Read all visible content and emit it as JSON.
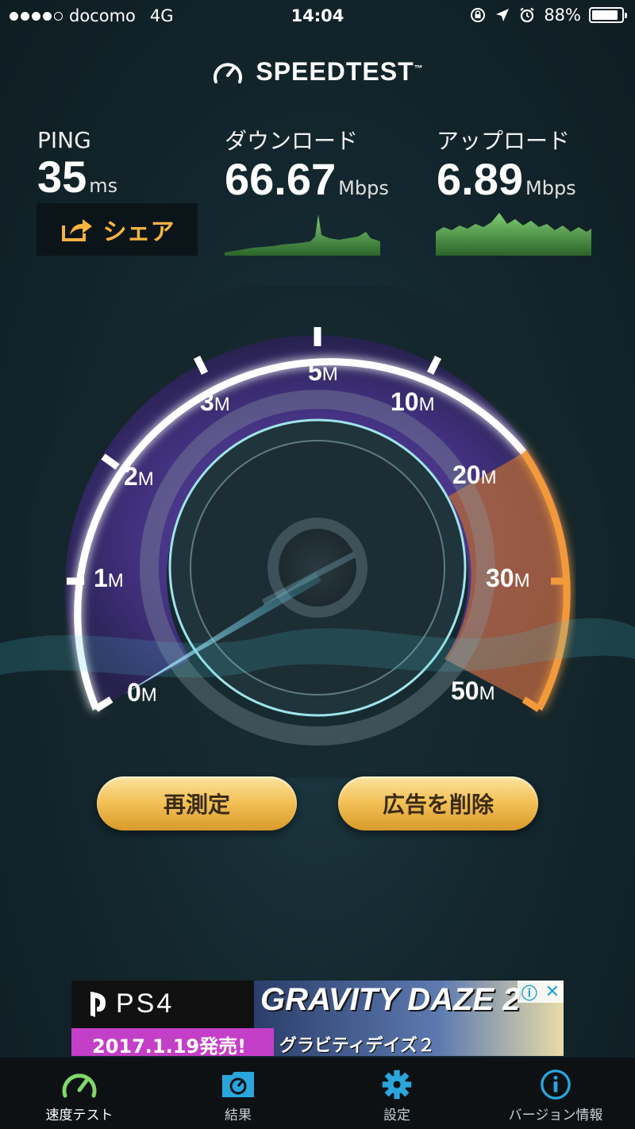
{
  "status_bar": {
    "carrier": "docomo",
    "network": "4G",
    "time": "14:04",
    "battery_pct": "88%",
    "battery_level": 0.88
  },
  "header": {
    "logo_text": "SPEEDTEST",
    "trademark": "™"
  },
  "results": {
    "ping": {
      "label": "PING",
      "value": "35",
      "unit": "ms"
    },
    "download": {
      "label": "ダウンロード",
      "value": "66.67",
      "unit": "Mbps"
    },
    "upload": {
      "label": "アップロード",
      "value": "6.89",
      "unit": "Mbps"
    }
  },
  "share_label": "シェア",
  "gauge": {
    "tick_labels": [
      {
        "num": "0",
        "unit": "M"
      },
      {
        "num": "1",
        "unit": "M"
      },
      {
        "num": "2",
        "unit": "M"
      },
      {
        "num": "3",
        "unit": "M"
      },
      {
        "num": "5",
        "unit": "M"
      },
      {
        "num": "10",
        "unit": "M"
      },
      {
        "num": "20",
        "unit": "M"
      },
      {
        "num": "30",
        "unit": "M"
      },
      {
        "num": "50",
        "unit": "M"
      }
    ],
    "colors": {
      "arc": "#ffffff",
      "high_range": "#f29a3a",
      "needle": "#8fe0f5"
    }
  },
  "buttons": {
    "retest": "再測定",
    "remove_ads": "広告を削除"
  },
  "ad": {
    "brand": "PS4",
    "title": "GRAVITY DAZE 2",
    "subtitle": "グラビティデイズ２",
    "release": "2017.1.19発売!"
  },
  "tabs": [
    {
      "label": "速度テスト",
      "icon": "speedometer-icon"
    },
    {
      "label": "結果",
      "icon": "results-icon"
    },
    {
      "label": "設定",
      "icon": "gear-icon"
    },
    {
      "label": "バージョン情報",
      "icon": "info-icon"
    }
  ],
  "accent_color": "#7fd86b"
}
